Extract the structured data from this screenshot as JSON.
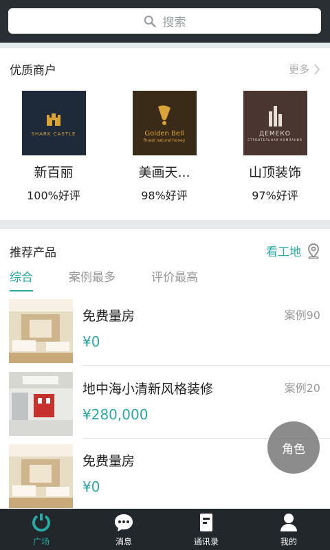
{
  "search": {
    "placeholder": "搜索"
  },
  "merchants": {
    "title": "优质商户",
    "more_label": "更多",
    "items": [
      {
        "name": "新百丽",
        "rating": "100%好评",
        "logo_text": "SHARK CASTLE",
        "logo_bg": "#1e2a3a"
      },
      {
        "name": "美画天...",
        "rating": "98%好评",
        "logo_text": "Golden Bell",
        "logo_sub": "finest natural honey",
        "logo_bg": "#3a2a18"
      },
      {
        "name": "山顶装饰",
        "rating": "97%好评",
        "logo_text": "ДЕМЕКО",
        "logo_sub": "СТРОИТЕЛЬНАЯ КОМПАНИЯ",
        "logo_bg": "#4a3630"
      }
    ]
  },
  "products": {
    "title": "推荐产品",
    "site_link": "看工地",
    "tabs": [
      "综合",
      "案例最多",
      "评价最高"
    ],
    "items": [
      {
        "name": "免费量房",
        "price": "¥0",
        "cases": "案例90"
      },
      {
        "name": "地中海小清新风格装修",
        "price": "¥280,000",
        "cases": "案例20"
      },
      {
        "name": "免费量房",
        "price": "¥0",
        "cases": ""
      }
    ]
  },
  "role_button": "角色",
  "tabbar": [
    "广场",
    "消息",
    "通讯录",
    "我的"
  ],
  "colors": {
    "accent": "#2aa8a4",
    "topbar": "#2a2f33",
    "tabbar": "#22272b"
  }
}
